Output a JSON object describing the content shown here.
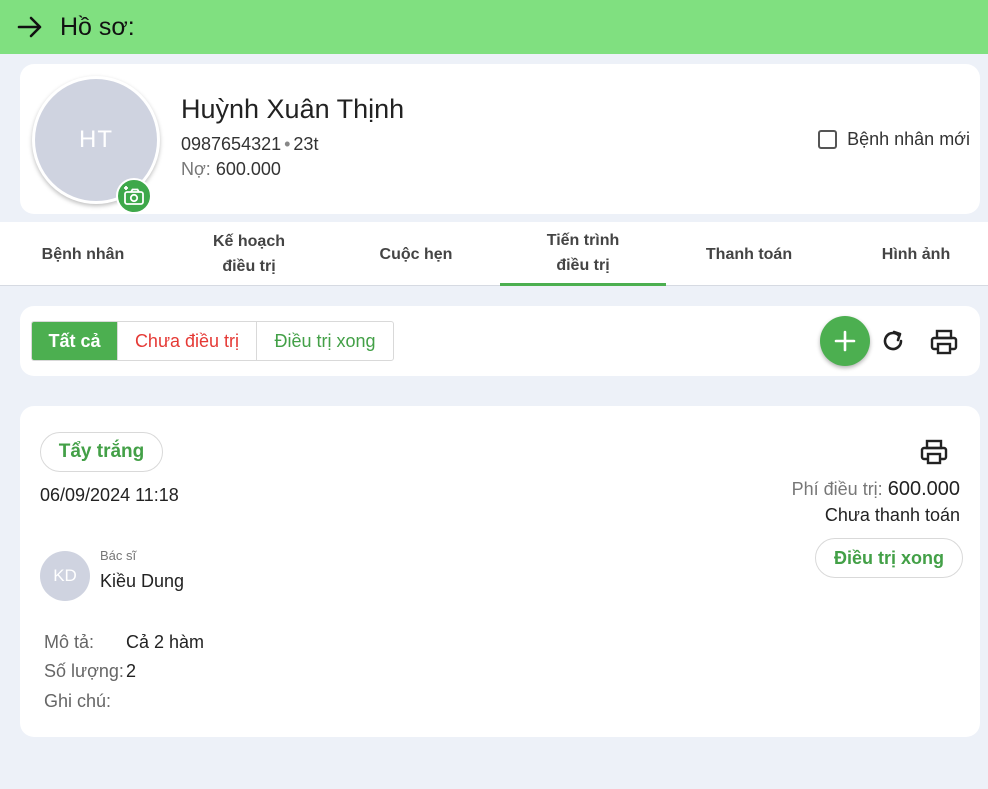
{
  "header": {
    "title": "Hồ sơ:",
    "back_icon": "arrow-right-icon"
  },
  "patient": {
    "initials": "HT",
    "name": "Huỳnh Xuân Thịnh",
    "phone": "0987654321",
    "separator": "•",
    "age": "23t",
    "debt_label": "Nợ:",
    "debt_value": "600.000",
    "new_patient_label": "Bệnh nhân mới"
  },
  "tabs": [
    {
      "line1": "Bệnh nhân",
      "line2": ""
    },
    {
      "line1": "Kế hoạch",
      "line2": "điều trị"
    },
    {
      "line1": "Cuộc hẹn",
      "line2": ""
    },
    {
      "line1": "Tiến trình",
      "line2": "điều trị"
    },
    {
      "line1": "Thanh toán",
      "line2": ""
    },
    {
      "line1": "Hình ảnh",
      "line2": ""
    }
  ],
  "filters": {
    "all": "Tất cả",
    "pending": "Chưa điều trị",
    "done": "Điều trị xong"
  },
  "treatment": {
    "tag": "Tẩy trắng",
    "datetime": "06/09/2024 11:18",
    "fee_label": "Phí điều trị:",
    "fee_value": "600.000",
    "payment_status": "Chưa thanh toán",
    "done_button": "Điều trị xong",
    "doctor_initials": "KD",
    "doctor_label": "Bác sĩ",
    "doctor_name": "Kiều Dung",
    "desc_label": "Mô tả:",
    "desc_value": "Cả 2 hàm",
    "qty_label": "Số lượng:",
    "qty_value": "2",
    "note_label": "Ghi chú:",
    "note_value": ""
  },
  "colors": {
    "header_bg": "#80e080",
    "accent": "#4caf50",
    "danger": "#e53935"
  }
}
